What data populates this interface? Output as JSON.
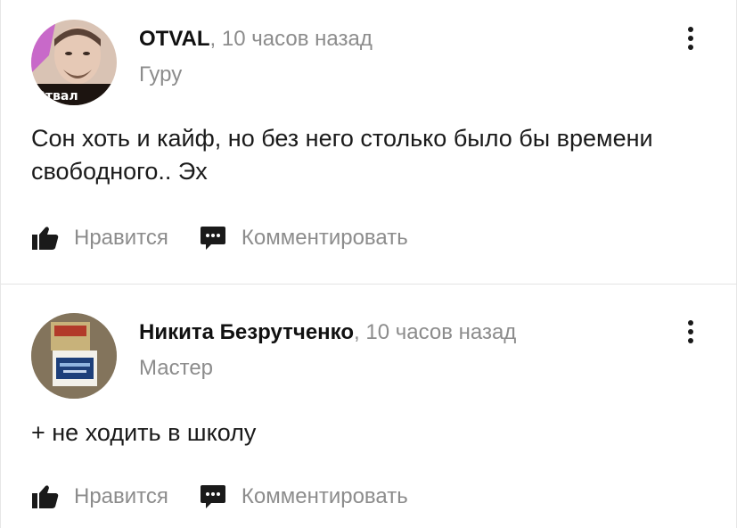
{
  "comments": [
    {
      "author": "OTVAL",
      "separator": ",",
      "time": "10 часов назад",
      "rank": "Гуру",
      "text": "Сон хоть и кайф, но без него столько было бы времени свободного.. Эх",
      "avatar_caption": "Отвал",
      "like_label": "Нравится",
      "comment_label": "Комментировать"
    },
    {
      "author": "Никита Безрутченко",
      "separator": ",",
      "time": "10 часов назад",
      "rank": "Мастер",
      "text": "+ не ходить в школу",
      "like_label": "Нравится",
      "comment_label": "Комментировать"
    }
  ],
  "icons": {
    "like": "thumbs-up-icon",
    "comment": "speech-bubble-icon",
    "menu": "more-vertical-icon"
  },
  "colors": {
    "author": "#111111",
    "muted": "#8c8c8c",
    "text": "#1a1a1a",
    "divider": "#e3e3e3"
  }
}
